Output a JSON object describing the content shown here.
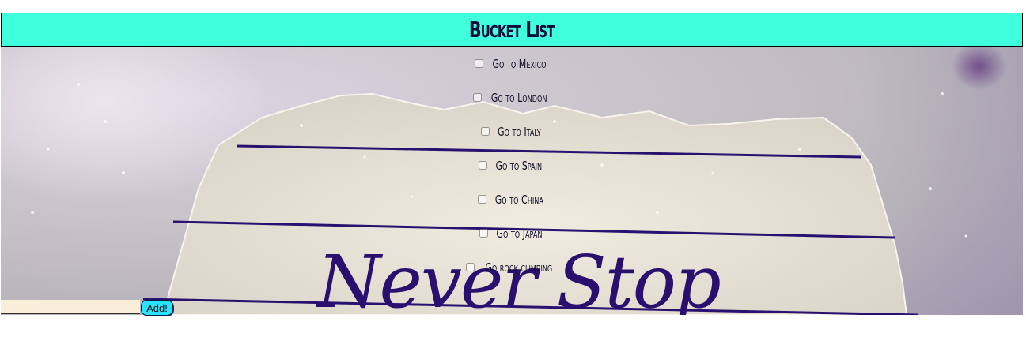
{
  "header": {
    "title": "Bucket List"
  },
  "colors": {
    "header_bg": "#40ffdc",
    "button_bg": "#2ae3ff",
    "input_bg": "#fbeed9",
    "ink": "#1e0b5c"
  },
  "background_image": {
    "handwriting": "Never Stop"
  },
  "list": {
    "items": [
      {
        "label": "Go to Mexico",
        "checked": false
      },
      {
        "label": "Go to London",
        "checked": false
      },
      {
        "label": "Go to Italy",
        "checked": false
      },
      {
        "label": "Go to Spain",
        "checked": false
      },
      {
        "label": "Go to China",
        "checked": false
      },
      {
        "label": "Go to Japan",
        "checked": false
      },
      {
        "label": "Go rock climbing",
        "checked": false
      }
    ]
  },
  "form": {
    "input_value": "",
    "input_placeholder": "",
    "add_label": "Add!"
  }
}
